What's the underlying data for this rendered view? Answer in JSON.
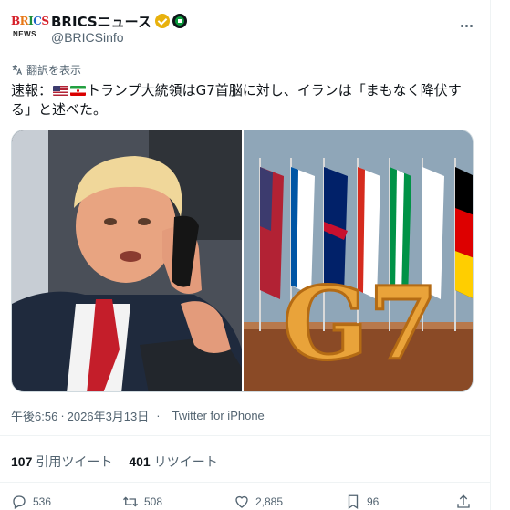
{
  "author": {
    "display_name": "BRICSニュース",
    "handle": "@BRICSinfo",
    "avatar_logo": "BRICS",
    "avatar_sub": "NEWS"
  },
  "translate_label": "翻訳を表示",
  "tweet": {
    "prefix": "速報：",
    "flags": [
      "us-flag",
      "iran-flag"
    ],
    "body": "トランプ大統領はG7首脳に対し、イランは「まもなく降伏する」と述べた。"
  },
  "images": [
    {
      "icon": "trump-on-phone-photo"
    },
    {
      "icon": "g7-flags-illustration",
      "text": "G7"
    }
  ],
  "meta": {
    "time": "午後6:56",
    "separator": "·",
    "date": "2026年3月13日",
    "source_dot": "·",
    "source": "Twitter for iPhone"
  },
  "stats": {
    "quotes_count": "107",
    "quotes_label": "引用ツイート",
    "retweets_count": "401",
    "retweets_label": "リツイート"
  },
  "actions": {
    "replies": "536",
    "retweets": "508",
    "likes": "2,885",
    "bookmarks": "96"
  },
  "colors": {
    "text": "#0f1419",
    "secondary": "#536471",
    "border": "#cfd9de",
    "verified": "#e8b10d"
  }
}
